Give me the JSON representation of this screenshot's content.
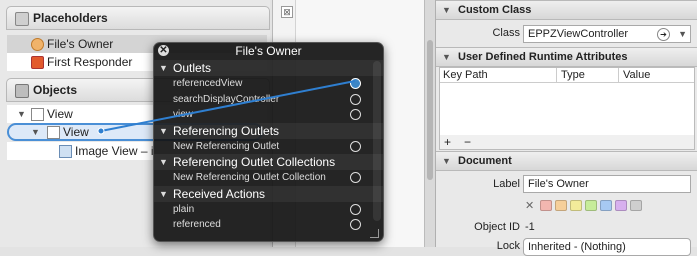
{
  "outline": {
    "placeholders_header": "Placeholders",
    "files_owner": "File's Owner",
    "first_responder": "First Responder",
    "objects_header": "Objects",
    "view_parent": "View",
    "view_selected": "View",
    "image_view": "Image View – i"
  },
  "popup": {
    "title": "File's Owner",
    "sections": [
      {
        "label": "Outlets",
        "items": [
          {
            "label": "referencedView",
            "connected": true
          },
          {
            "label": "searchDisplayController",
            "connected": false
          },
          {
            "label": "view",
            "connected": false
          }
        ]
      },
      {
        "label": "Referencing Outlets",
        "items": [
          {
            "label": "New Referencing Outlet",
            "connected": false
          }
        ]
      },
      {
        "label": "Referencing Outlet Collections",
        "items": [
          {
            "label": "New Referencing Outlet Collection",
            "connected": false
          }
        ]
      },
      {
        "label": "Received Actions",
        "items": [
          {
            "label": "plain",
            "connected": false
          },
          {
            "label": "referenced",
            "connected": false
          }
        ]
      }
    ]
  },
  "inspector": {
    "custom_class_header": "Custom Class",
    "class_label": "Class",
    "class_value": "EPPZViewController",
    "udra_header": "User Defined Runtime Attributes",
    "col_key_path": "Key Path",
    "col_type": "Type",
    "col_value": "Value",
    "add_label": "+",
    "remove_label": "−",
    "document_header": "Document",
    "label_label": "Label",
    "label_value": "File's Owner",
    "object_id_label": "Object ID",
    "object_id_value": "-1",
    "lock_label": "Lock",
    "lock_value": "Inherited - (Nothing)",
    "color_clear": "✕",
    "label_colors": [
      "#f2b6b0",
      "#f6cf9a",
      "#f2ec9a",
      "#c7ec9a",
      "#a7c9f2",
      "#d7b0ee",
      "#cfcfcf"
    ]
  }
}
